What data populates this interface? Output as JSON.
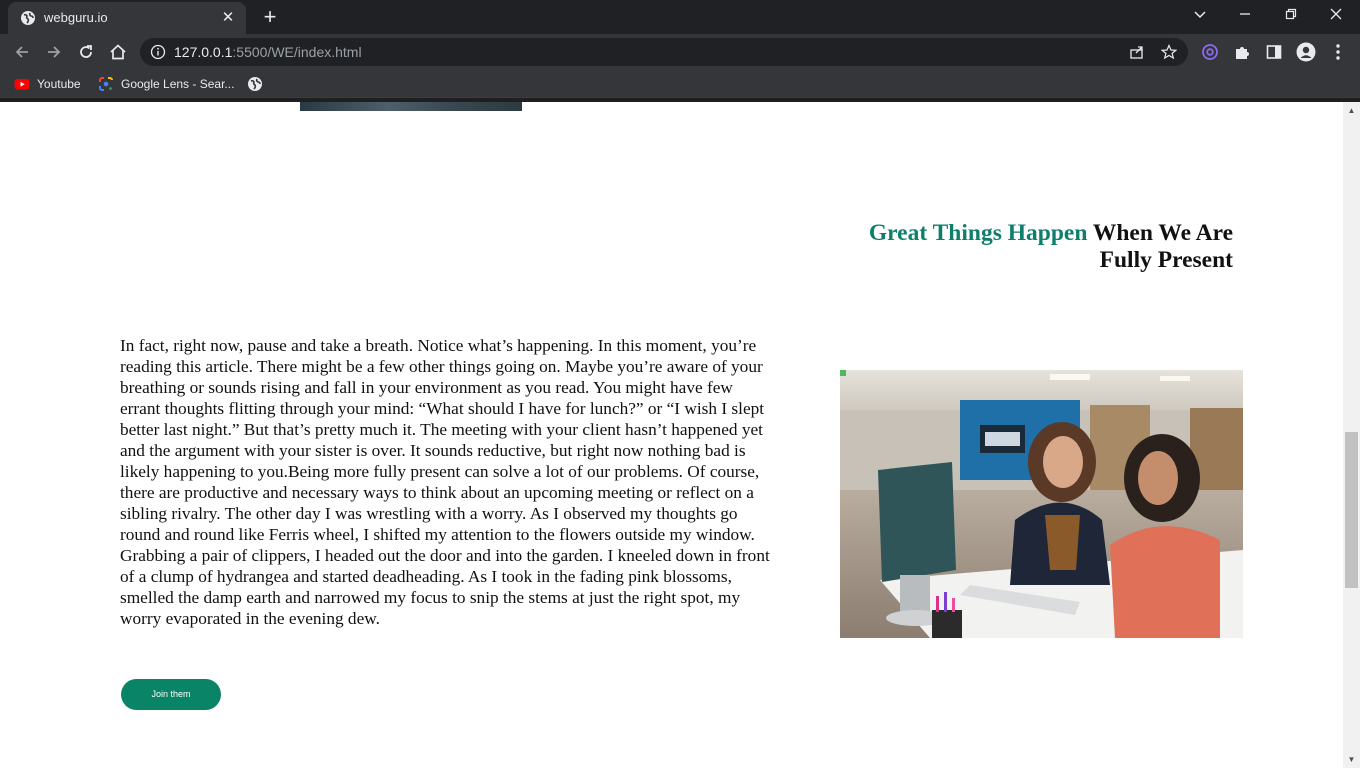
{
  "browser": {
    "tab_title": "webguru.io",
    "tab_close_glyph": "✕",
    "new_tab_glyph": "+",
    "url_host": "127.0.0.1",
    "url_path": ":5500/WE/index.html",
    "bookmarks": [
      {
        "label": "Youtube",
        "icon": "youtube-icon"
      },
      {
        "label": "Google Lens - Sear...",
        "icon": "google-lens-icon"
      },
      {
        "label": "",
        "icon": "globe-icon"
      }
    ],
    "colors": {
      "tabstrip": "#202124",
      "toolbar": "#35363a",
      "omnibox": "#202124"
    }
  },
  "page": {
    "headline_accent": "Great Things Happen",
    "headline_rest": "When We Are Fully Present",
    "article_text": "In fact, right now, pause and take a breath. Notice what’s happening. In this moment, you’re reading this article. There might be a few other things going on. Maybe you’re aware of your breathing or sounds rising and fall in your environment as you read. You might have few errant thoughts flitting through your mind: “What should I have for lunch?” or “I wish I slept better last night.” But that’s pretty much it. The meeting with your client hasn’t happened yet and the argument with your sister is over. It sounds reductive, but right now nothing bad is likely happening to you.Being more fully present can solve a lot of our problems. Of course, there are productive and necessary ways to think about an upcoming meeting or reflect on a sibling rivalry. The other day I was wrestling with a worry. As I observed my thoughts go round and round like Ferris wheel, I shifted my attention to the flowers outside my window. Grabbing a pair of clippers, I headed out the door and into the garden. I kneeled down in front of a clump of hydrangea and started deadheading. As I took in the fading pink blossoms, smelled the damp earth and narrowed my focus to snip the stems at just the right spot, my worry evaporated in the evening dew.",
    "cta_label": "Join them",
    "colors": {
      "accent": "#0d7f6a",
      "button": "#0a8466"
    }
  }
}
